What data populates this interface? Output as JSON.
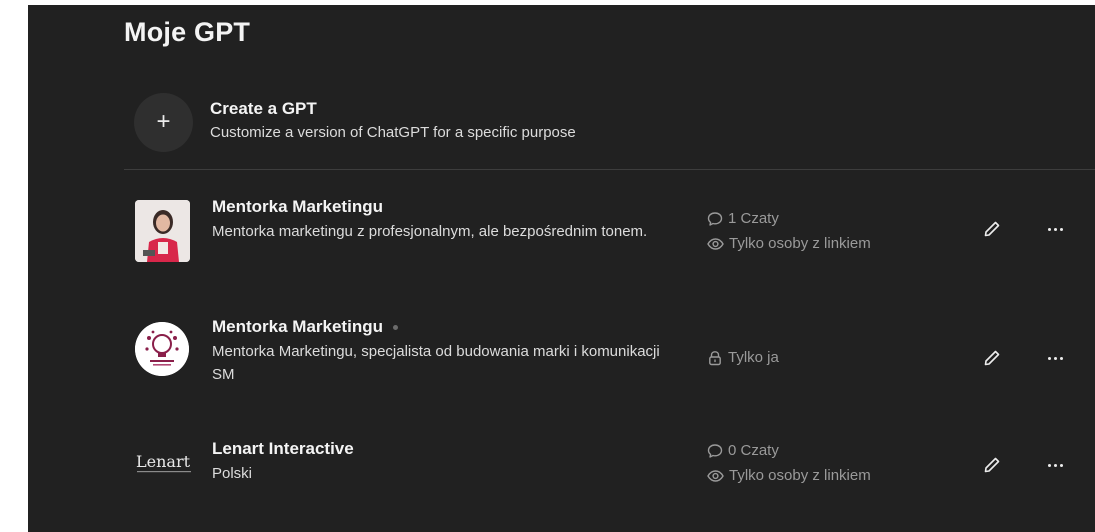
{
  "page": {
    "title": "Moje GPT"
  },
  "create": {
    "title": "Create a GPT",
    "description": "Customize a version of ChatGPT for a specific purpose",
    "icon": "plus-icon"
  },
  "gpts": [
    {
      "name": "Mentorka Marketingu",
      "description": "Mentorka marketingu z profesjonalnym, ale bezpośrednim tonem.",
      "chats": "1 Czaty",
      "visibility": "Tylko osoby z linkiem",
      "visibility_icon": "eye-icon",
      "avatar": "photo-avatar"
    },
    {
      "name": "Mentorka Marketingu",
      "description": "Mentorka Marketingu, specjalista od budowania marki i komunikacji SM",
      "visibility": "Tylko ja",
      "visibility_icon": "lock-icon",
      "avatar": "lightbulb-logo-avatar"
    },
    {
      "name": "Lenart Interactive",
      "description": "Polski",
      "chats": "0 Czaty",
      "visibility": "Tylko osoby z linkiem",
      "visibility_icon": "eye-icon",
      "avatar": "lenart-logo-avatar",
      "logo_text": "Lenart"
    }
  ],
  "colors": {
    "background": "#212121",
    "text": "#ececec",
    "muted": "#9a9a9a",
    "divider": "#3d3d3d"
  }
}
